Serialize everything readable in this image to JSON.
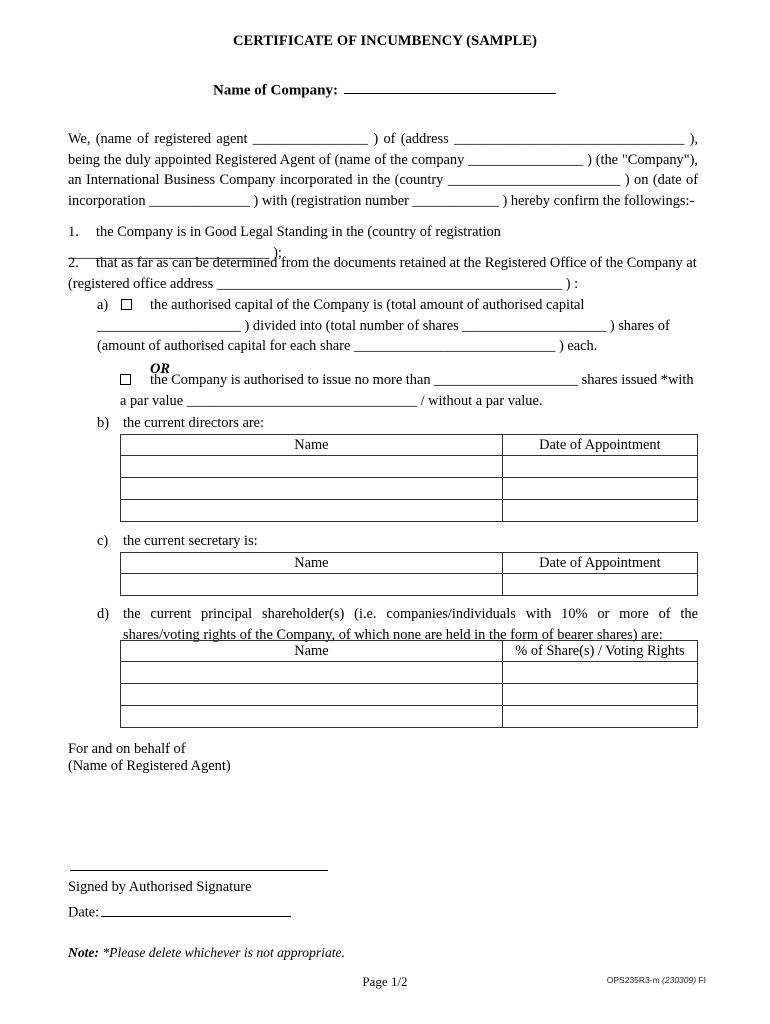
{
  "document": {
    "title": "CERTIFICATE OF INCUMBENCY (SAMPLE)",
    "company_label": "Name of Company:"
  },
  "intro": {
    "text": "We, (name of registered agent ________________ ) of (address ________________________________ ), being the duly appointed Registered Agent of (name of the company ________________ ) (the \"Company\"), an International Business Company incorporated in the (country ________________________ ) on (date of incorporation ______________ ) with (registration number ____________ ) hereby confirm the followings:-"
  },
  "items": {
    "one": {
      "number": "1.",
      "text": "the Company is in Good Legal Standing in the (country of registration ____________________________ );"
    },
    "two": {
      "number": "2.",
      "text": "that as far as can be determined from the documents retained at the Registered Office of the Company at (registered office address ________________________________________________ ) :"
    }
  },
  "sub_items": {
    "a": {
      "letter": "a)",
      "text": "the authorised capital of the Company is (total amount of authorised capital ____________________ ) divided into (total number of shares ____________________ ) shares of (amount of authorised capital for each share ____________________________ ) each.",
      "or_label": "OR",
      "alternative_text": "the Company is authorised to issue no more than ____________________ shares issued *with a par value ________________________________ / without a par value."
    },
    "b": {
      "letter": "b)",
      "text": "the current directors are:"
    },
    "c": {
      "letter": "c)",
      "text": "the current secretary is:"
    },
    "d": {
      "letter": "d)",
      "text": "the current principal shareholder(s) (i.e. companies/individuals with 10% or more of the shares/voting rights of the Company, of which none are held in the form of bearer shares) are:"
    }
  },
  "tables": {
    "directors": {
      "headers": [
        "Name",
        "Date of Appointment"
      ],
      "rows": [
        [
          "",
          ""
        ],
        [
          "",
          ""
        ],
        [
          "",
          ""
        ]
      ]
    },
    "secretary": {
      "headers": [
        "Name",
        "Date of Appointment"
      ],
      "rows": [
        [
          "",
          ""
        ]
      ]
    },
    "shareholders": {
      "headers": [
        "Name",
        "% of Share(s) / Voting Rights"
      ],
      "rows": [
        [
          "",
          ""
        ],
        [
          "",
          ""
        ],
        [
          "",
          ""
        ]
      ]
    }
  },
  "signature": {
    "for_and_on_behalf": "For and on behalf of",
    "registered_agent": "(Name of Registered Agent)",
    "signed_by": "Signed by Authorised Signature",
    "date_label": "Date:"
  },
  "note": {
    "label": "Note:",
    "text": " *Please delete whichever is not appropriate."
  },
  "footer": {
    "page_number": "Page 1/2",
    "code_prefix": "OPS235R3-m ",
    "code_date": "(230309)",
    "code_suffix": " FI"
  }
}
